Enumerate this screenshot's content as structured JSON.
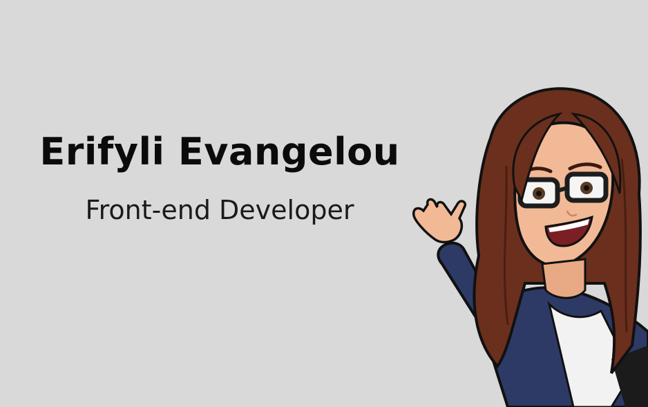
{
  "background_color": "#d9d9d9",
  "profile": {
    "name": "Erifyli Evangelou",
    "role": "Front-end Developer"
  },
  "avatar": {
    "icon": "bitmoji-avatar-waving",
    "hair_color": "#6b2f1d",
    "jacket_color": "#2e3a66",
    "skin_color": "#f2b996"
  }
}
